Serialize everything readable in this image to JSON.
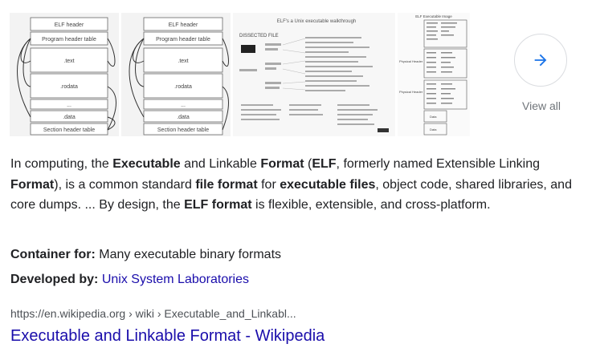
{
  "images": [
    {
      "name": "elf-layout-diagram-1",
      "boxes": [
        "ELF header",
        "Program header table",
        ".text",
        ".rodata",
        "...",
        ".data",
        "Section header table"
      ]
    },
    {
      "name": "elf-layout-diagram-2",
      "boxes": [
        "ELF header",
        "Program header table",
        ".text",
        ".rodata",
        "...",
        ".data",
        "Section header table"
      ]
    },
    {
      "name": "elf-dissected-file-diagram",
      "heading": "ELF's a Unix executable walkthrough",
      "subheading": "DISSECTED FILE"
    },
    {
      "name": "elf-executable-image-table",
      "heading": "ELF Executable Image",
      "row_labels": [
        "Physical Header",
        "Physical Header"
      ],
      "footer_cells": [
        "Data",
        "Data"
      ]
    }
  ],
  "view_all": {
    "label": "View all",
    "icon": "arrow-right-icon"
  },
  "description": {
    "segments": [
      {
        "text": "In computing, the ",
        "bold": false
      },
      {
        "text": "Executable",
        "bold": true
      },
      {
        "text": " and Linkable ",
        "bold": false
      },
      {
        "text": "Format",
        "bold": true
      },
      {
        "text": " (",
        "bold": false
      },
      {
        "text": "ELF",
        "bold": true
      },
      {
        "text": ", formerly named Extensible Linking ",
        "bold": false
      },
      {
        "text": "Format",
        "bold": true
      },
      {
        "text": "), is a common standard ",
        "bold": false
      },
      {
        "text": "file format",
        "bold": true
      },
      {
        "text": " for ",
        "bold": false
      },
      {
        "text": "executable files",
        "bold": true
      },
      {
        "text": ", object code, shared libraries, and core dumps. ... By design, the ",
        "bold": false
      },
      {
        "text": "ELF format",
        "bold": true
      },
      {
        "text": " is flexible, extensible, and cross-platform.",
        "bold": false
      }
    ]
  },
  "facts": [
    {
      "label": "Container for:",
      "value": "Many executable binary formats",
      "is_link": false
    },
    {
      "label": "Developed by:",
      "value": "Unix System Laboratories",
      "is_link": true
    }
  ],
  "source": {
    "breadcrumb": "https://en.wikipedia.org › wiki › Executable_and_Linkabl...",
    "title": "Executable and Linkable Format - Wikipedia"
  },
  "colors": {
    "link": "#1a0dab",
    "text": "#202124",
    "muted": "#70757a",
    "accent_arrow": "#1a73e8"
  }
}
